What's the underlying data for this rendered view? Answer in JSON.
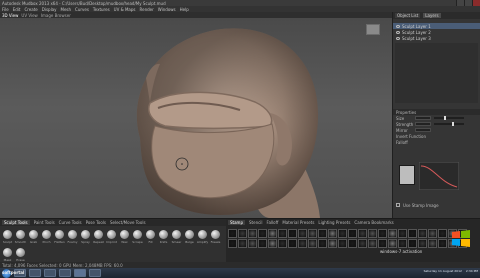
{
  "window": {
    "title": "Autodesk Mudbox 2013 x64 - C:/Users/Bud/Desktop/mudbox/head/My Sculpt.mud"
  },
  "menu": [
    "File",
    "Edit",
    "Create",
    "Display",
    "Mesh",
    "Curves",
    "Textures",
    "UV & Maps",
    "Render",
    "Windows",
    "Help"
  ],
  "toolbar": [
    "3D View",
    "UV View",
    "Image Browser"
  ],
  "panel": {
    "tabs": [
      "Object List",
      "Layers"
    ],
    "rows": [
      {
        "label": "Sculpt Layer 1",
        "selected": true
      },
      {
        "label": "Sculpt Layer 2",
        "selected": false
      },
      {
        "label": "Sculpt Layer 3",
        "selected": false
      }
    ],
    "properties_title": "Properties",
    "props": [
      {
        "label": "Size",
        "value": "1.23"
      },
      {
        "label": "Strength",
        "value": "0.6"
      },
      {
        "label": "Mirror",
        "value": "Off"
      },
      {
        "label": "Invert Function",
        "value": ""
      }
    ],
    "falloff_label": "Falloff",
    "stamp_label": "Use Stamp Image"
  },
  "shelf": {
    "tabs": [
      "Sculpt Tools",
      "Paint Tools",
      "Curve Tools",
      "Pose Tools",
      "Select/Move Tools"
    ],
    "active_tab": "Sculpt Tools",
    "brushes": [
      "Sculpt",
      "Smooth",
      "Grab",
      "Pinch",
      "Flatten",
      "Foamy",
      "Spray",
      "Repeat",
      "Imprint",
      "Wax",
      "Scrape",
      "Fill",
      "Knife",
      "Smear",
      "Bulge",
      "Amplify",
      "Freeze",
      "Mask",
      "Erase"
    ]
  },
  "stamps": {
    "tabs": [
      "Stamp",
      "Stencil",
      "Falloff",
      "Material Presets",
      "Lighting Presets",
      "Camera Bookmarks"
    ],
    "active_tab": "Stamp",
    "count": 48
  },
  "status": {
    "text": "Total: 4,096 Faces  Selected: 0  GPU Mem: 2,048MB  FPS: 60.0"
  },
  "taskbar": {
    "tray_text": "Saturday 11 August 2012",
    "tray_time": "2:34 PM"
  },
  "watermark_text": "windows-7 activation",
  "logo_text": "softportal",
  "colors": {
    "viewport": "#555555",
    "panel": "#353535",
    "selection": "#4a5d77",
    "head": "#a48c7c"
  }
}
